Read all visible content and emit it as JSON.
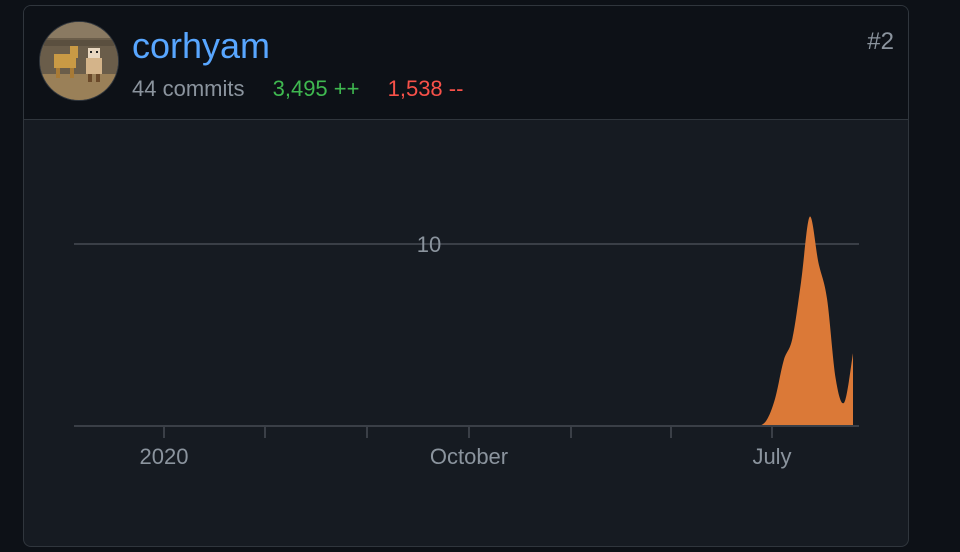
{
  "contributor": {
    "username": "corhyam",
    "commits": "44 commits",
    "additions": "3,495 ++",
    "deletions": "1,538 --",
    "rank": "#2",
    "avatar_icon": "pixel-art-avatar"
  },
  "colors": {
    "username": "#58a6ff",
    "additions": "#3fb950",
    "deletions": "#f85149",
    "area_fill": "#db7937"
  },
  "chart_data": {
    "type": "area",
    "title": "",
    "xlabel": "",
    "ylabel": "",
    "x_ticks": [
      "2020",
      "October",
      "July"
    ],
    "y_ticks": [
      10
    ],
    "ylim": [
      0,
      13
    ],
    "grid": true,
    "series": [
      {
        "values": [
          0,
          0,
          0,
          0,
          0,
          0,
          0,
          0,
          0,
          0,
          0,
          0,
          0,
          0,
          0,
          0,
          0,
          0,
          0,
          0,
          0,
          0,
          0,
          0,
          0,
          0,
          0,
          0,
          0,
          0,
          0,
          0,
          0,
          0,
          0,
          0,
          0,
          0,
          0,
          0,
          0,
          0,
          0,
          0,
          0,
          0,
          0,
          0,
          0,
          0,
          0,
          0,
          0,
          0,
          0,
          0,
          0,
          0,
          0,
          0,
          0,
          0,
          0,
          0,
          0,
          0,
          0,
          0,
          0,
          0,
          0,
          0,
          0,
          0,
          0,
          0,
          0,
          0,
          0,
          0.3,
          1.5,
          3.6,
          4.8,
          7.9,
          11.5,
          9.0,
          7.0,
          2.6,
          1.3,
          4.0
        ]
      }
    ]
  }
}
